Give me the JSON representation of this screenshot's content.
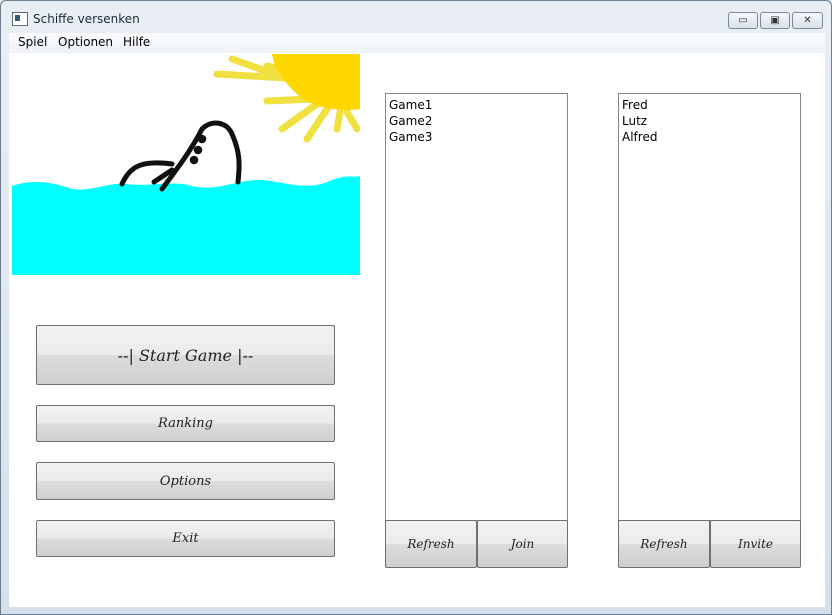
{
  "window": {
    "title": "Schiffe versenken",
    "controls": {
      "minimize": "▭",
      "maximize": "▣",
      "close": "✕"
    }
  },
  "menu": {
    "items": [
      "Spiel",
      "Optionen",
      "Hilfe"
    ]
  },
  "main_menu": {
    "start_game": "--| Start Game |--",
    "ranking": "Ranking",
    "options": "Options",
    "exit": "Exit"
  },
  "games_panel": {
    "items": [
      "Game1",
      "Game2",
      "Game3"
    ],
    "refresh_label": "Refresh",
    "join_label": "Join"
  },
  "players_panel": {
    "items": [
      "Fred",
      "Lutz",
      "Alfred"
    ],
    "refresh_label": "Refresh",
    "invite_label": "Invite"
  },
  "colors": {
    "sea": "#00ffff",
    "sun": "#ffd700",
    "sun_rays": "#f0e040",
    "ship": "#111111"
  }
}
